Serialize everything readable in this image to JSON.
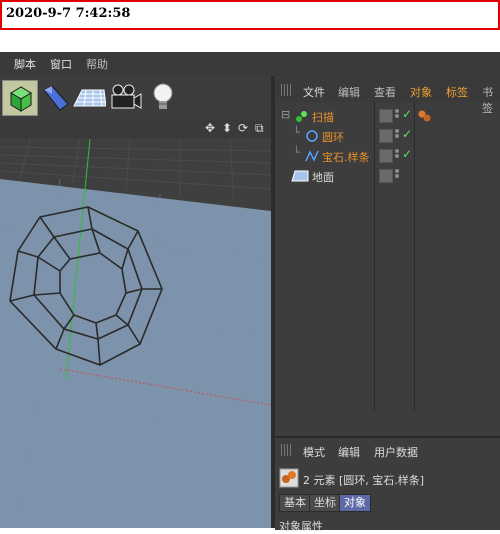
{
  "timestamp": "2020-9-7 7:42:58",
  "menu": {
    "items": [
      "脚本",
      "窗口",
      "帮助"
    ]
  },
  "toolbar": {
    "icons": [
      "cube-icon",
      "spline-pen-icon",
      "plane-grid-icon",
      "camera-icon",
      "light-bulb-icon"
    ]
  },
  "viewport": {
    "nav_icons": [
      "move-icon",
      "zoom-icon",
      "rotate-icon",
      "maximize-icon"
    ]
  },
  "objects": {
    "tabs": [
      "文件",
      "编辑",
      "查看",
      "对象",
      "标签",
      "书签"
    ],
    "rows": [
      {
        "label": "扫描",
        "icon": "sweep-icon",
        "color": "#e8922c"
      },
      {
        "label": "圆环",
        "icon": "circle-icon",
        "color": "#e8922c"
      },
      {
        "label": "宝石.样条",
        "icon": "spline-icon",
        "color": "#e8922c"
      },
      {
        "label": "地面",
        "icon": "floor-icon",
        "color": "#dddddd"
      }
    ]
  },
  "attributes": {
    "tabs": [
      "模式",
      "编辑",
      "用户数据"
    ],
    "info": "2 元素 [圆环, 宝石.样条]",
    "buttons": [
      "基本",
      "坐标",
      "对象"
    ],
    "active_button": "对象",
    "section": "对象属性"
  }
}
